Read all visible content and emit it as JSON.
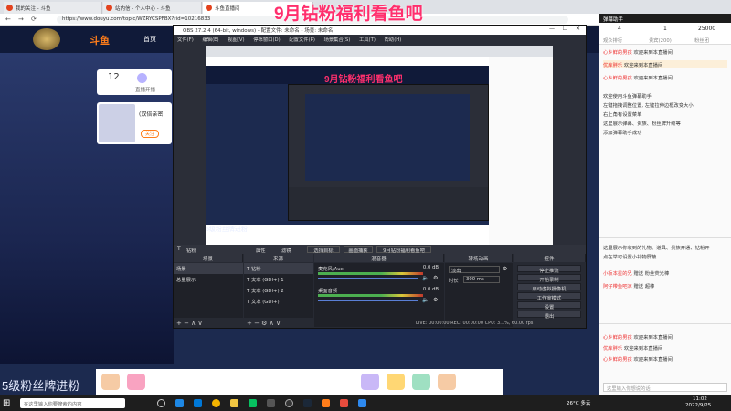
{
  "browser": {
    "tabs": [
      {
        "label": "我的关注 - 斗鱼"
      },
      {
        "label": "站内信 - 个人中心 - 斗鱼"
      },
      {
        "label": "斗鱼直播间"
      }
    ],
    "url": "https://www.douyu.com/topic/WZRYCSPFBX?rid=10216833"
  },
  "douyu": {
    "logo": "斗鱼",
    "nav_home": "首页",
    "stats_count": "12",
    "stats_label": "直播开播",
    "room_title": "(双倍亲密",
    "room_follow": "关注"
  },
  "banner": "9月钻粉福利看鱼吧",
  "bottom_overlay_text": "5级粉丝牌进粉",
  "obs": {
    "title": "OBS 27.2.4 (64-bit, windows) - 配置文件: 未命名 - 场景: 未命名",
    "menu": [
      "文件(F)",
      "编辑(E)",
      "视图(V)",
      "停靠窗口(D)",
      "配置文件(P)",
      "场景集合(S)",
      "工具(T)",
      "帮助(H)"
    ],
    "toolbar": [
      "属性",
      "滤镜",
      "选择目标",
      "画面捕获",
      "9月钻粉福利看鱼吧"
    ],
    "dock_headers": [
      "场景",
      "来源",
      "混音器",
      "转场动画",
      "控件"
    ],
    "scenes": [
      "场景",
      "总量展示"
    ],
    "sources": [
      "钻粉",
      "文本 (GDI+) 1",
      "文本 (GDI+) 2",
      "文本 (GDI+)"
    ],
    "mixer": [
      "麦克风/Aux",
      "桌面音频"
    ],
    "mixer_db": [
      "0.0 dB",
      "0.0 dB"
    ],
    "transition": {
      "type": "淡出",
      "duration_label": "时长",
      "duration": "300 ms"
    },
    "controls": [
      "停止推流",
      "开始录制",
      "启动虚拟摄像机",
      "工作室模式",
      "设置",
      "退出"
    ],
    "status": "LIVE: 00:00:00   REC: 00:00:00   CPU: 3.1%, 60.00 fps"
  },
  "chat": {
    "header": "弹幕助手",
    "tabs": [
      "观众排行",
      "贵宾(200)",
      "粉丝团"
    ],
    "stats": [
      "4",
      "1",
      "25000"
    ],
    "lines": [
      {
        "user": "心乡鲜的男孩",
        "text": "欢迎来到本直播间",
        "hi": false
      },
      {
        "user": "优库胖乐",
        "text": "欢迎来到本直播间",
        "hi": true
      },
      {
        "user": "心乡鲜的男孩",
        "text": "欢迎来到本直播间",
        "hi": false
      }
    ],
    "notice": [
      "欢迎使用斗鱼弹幕助手",
      "左键拖拽调整位置, 左键拉伸边框改变大小",
      "右上角有设置菜单",
      "这里展示弹幕、贵族、粉丝牌升级等",
      "添加弹幕助手成功"
    ],
    "notice2": [
      "这里展示你收到的礼物、道具、贵族开通、钻粉开",
      "点在举可设置小礼物屏蔽"
    ],
    "gifts": [
      {
        "user": "小板本星的兄",
        "text": "赠送 粉丝荧光棒"
      },
      {
        "user": "阿仔带鱼吧凉",
        "text": "赠送 超棒"
      }
    ],
    "lines2": [
      {
        "user": "心乡鲜的男孩",
        "text": "欢迎来到本直播间"
      },
      {
        "user": "优库胖乐",
        "text": "欢迎来到本直播间"
      },
      {
        "user": "心乡鲜的男孩",
        "text": "欢迎来到本直播间"
      }
    ],
    "input_placeholder": "这里输入你想说的话"
  },
  "taskbar": {
    "search_placeholder": "在这里输入你要搜索的内容",
    "weather": "26°C 多云",
    "time": "11:02",
    "date": "2022/9/25"
  }
}
